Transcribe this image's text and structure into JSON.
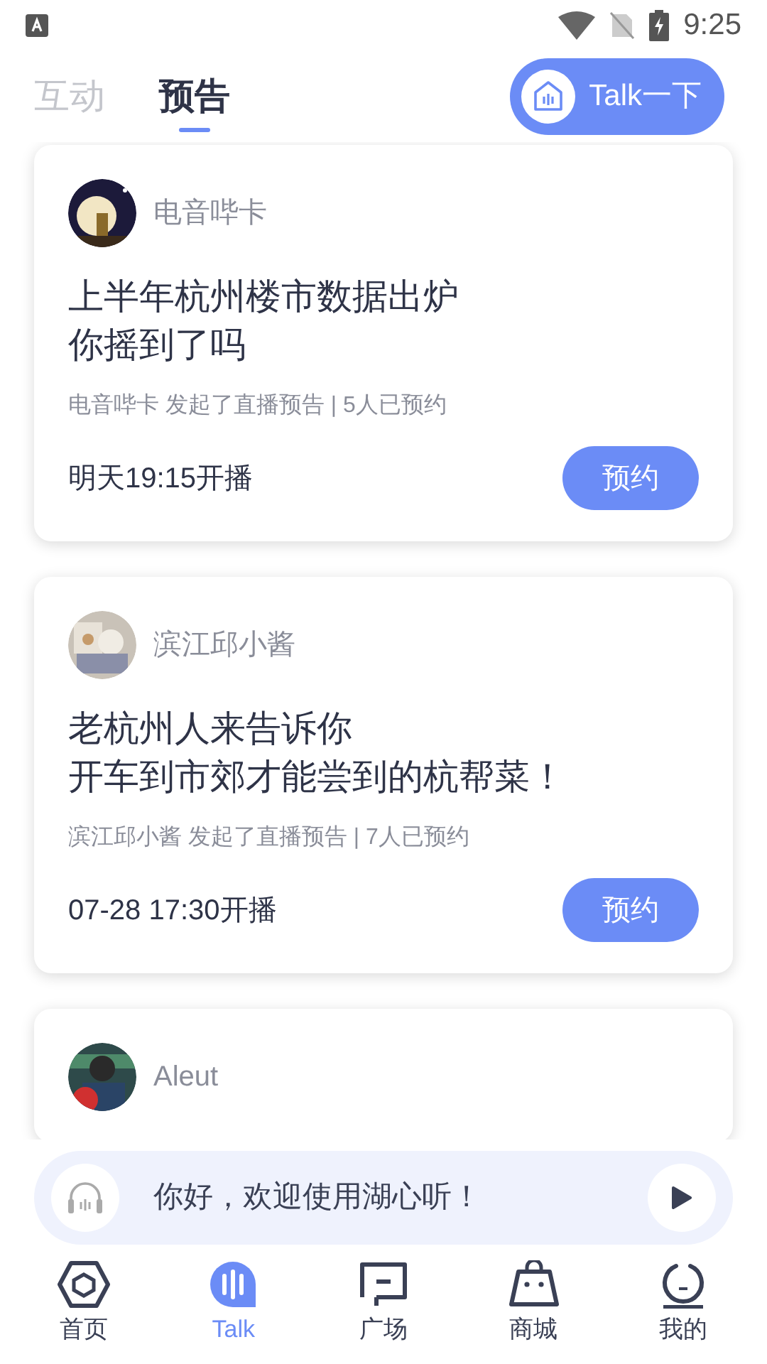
{
  "status_bar": {
    "time": "9:25"
  },
  "tabs": [
    {
      "label": "互动",
      "selected": false
    },
    {
      "label": "预告",
      "selected": true
    }
  ],
  "talk_button": {
    "label": "Talk一下"
  },
  "cards": [
    {
      "author": "电音哔卡",
      "title_lines": [
        "上半年杭州楼市数据出炉",
        "你摇到了吗"
      ],
      "meta": "电音哔卡 发起了直播预告 | 5人已预约",
      "time": "明天19:15开播",
      "button": "预约"
    },
    {
      "author": "滨江邱小酱",
      "title_lines": [
        "老杭州人来告诉你",
        "开车到市郊才能尝到的杭帮菜！"
      ],
      "meta": "滨江邱小酱 发起了直播预告 | 7人已预约",
      "time": "07-28 17:30开播",
      "button": "预约"
    },
    {
      "author": "Aleut"
    }
  ],
  "player": {
    "text": "你好，欢迎使用湖心听！"
  },
  "nav": [
    {
      "label": "首页",
      "selected": false
    },
    {
      "label": "Talk",
      "selected": true
    },
    {
      "label": "广场",
      "selected": false
    },
    {
      "label": "商城",
      "selected": false
    },
    {
      "label": "我的",
      "selected": false
    }
  ]
}
